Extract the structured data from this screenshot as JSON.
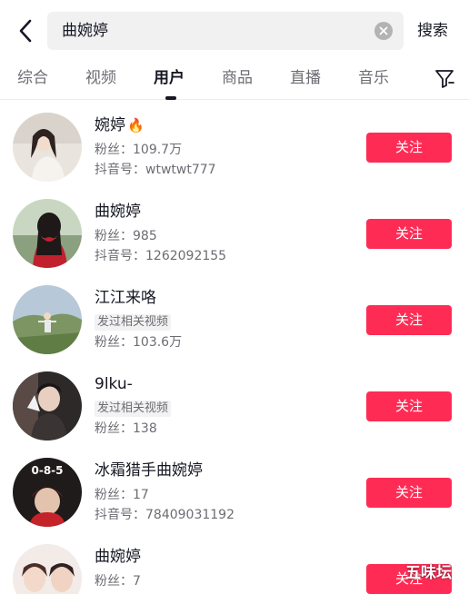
{
  "search": {
    "query": "曲婉婷",
    "button_label": "搜索"
  },
  "tabs": [
    {
      "label": "综合"
    },
    {
      "label": "视频"
    },
    {
      "label": "用户"
    },
    {
      "label": "商品"
    },
    {
      "label": "直播"
    },
    {
      "label": "音乐"
    }
  ],
  "active_tab": "用户",
  "users": [
    {
      "name": "婉婷",
      "emoji": "🔥",
      "line1": "粉丝：109.7万",
      "line2": "抖音号：wtwtwt777",
      "button": "关注"
    },
    {
      "name": "曲婉婷",
      "line1": "粉丝：985",
      "line2": "抖音号：1262092155",
      "button": "关注"
    },
    {
      "name": "江江来咯",
      "tag": "发过相关视频",
      "line2": "粉丝：103.6万",
      "button": "关注"
    },
    {
      "name": "9lku-",
      "tag": "发过相关视频",
      "line2": "粉丝：138",
      "button": "关注"
    },
    {
      "name": "冰霜猎手曲婉婷",
      "avatar_text": "0-8-5",
      "line1": "粉丝：17",
      "line2": "抖音号：78409031192",
      "button": "关注"
    },
    {
      "name": "曲婉婷",
      "line1": "粉丝：7",
      "button": "关注"
    }
  ],
  "watermark": "五味坛",
  "colors": {
    "accent": "#fe2c55",
    "text_primary": "#161823",
    "text_secondary": "#6c6d73",
    "search_bg": "#f1f1f2"
  },
  "icons": [
    "back-arrow-icon",
    "clear-icon",
    "filter-icon",
    "fire-icon"
  ]
}
